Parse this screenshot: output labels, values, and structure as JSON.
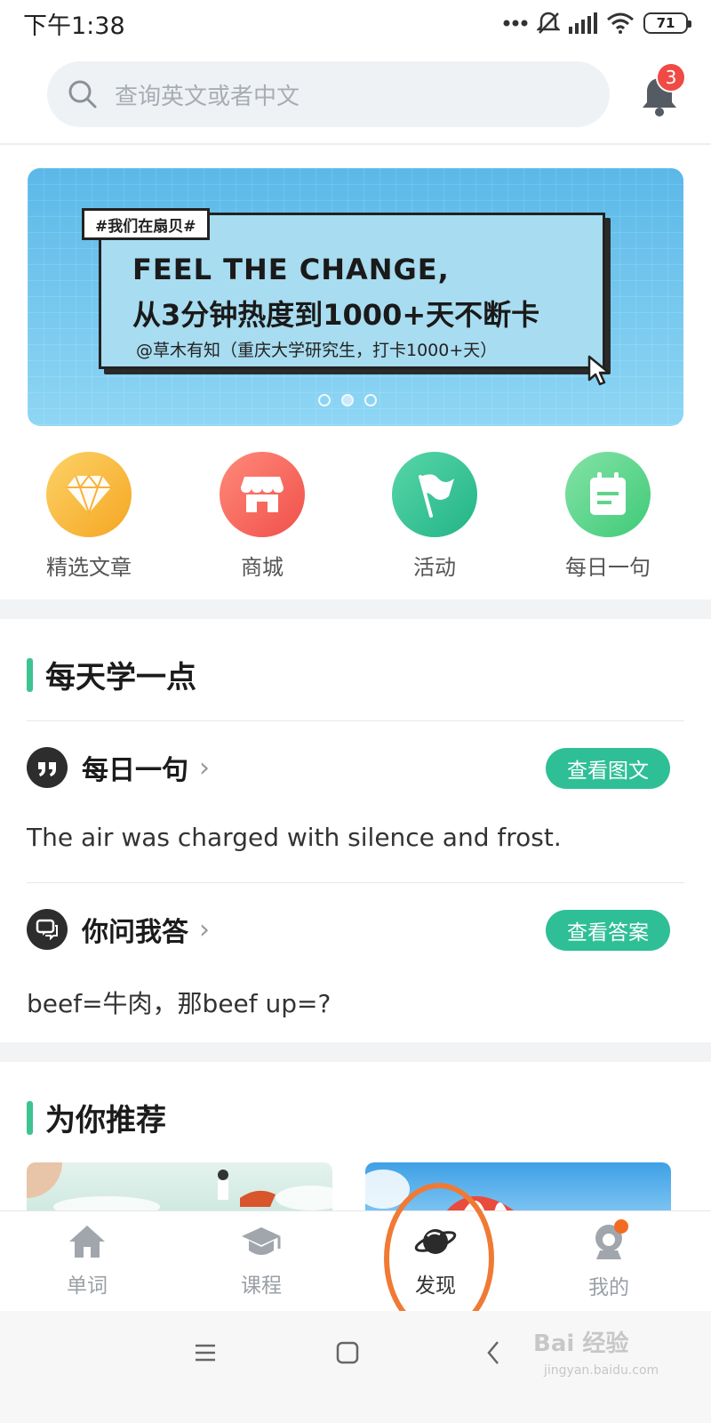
{
  "status": {
    "time": "下午1:38",
    "battery": "71"
  },
  "header": {
    "search_placeholder": "查询英文或者中文",
    "notification_count": "3"
  },
  "banner": {
    "tag": "#我们在扇贝#",
    "title_line1": "FEEL THE CHANGE,",
    "title_line2": "从3分钟热度到1000+天不断卡",
    "subtitle": "@草木有知（重庆大学研究生，打卡1000+天）",
    "page_count": 3,
    "active_page": 1
  },
  "quick_links": [
    {
      "label": "精选文章",
      "icon": "diamond-icon",
      "color": "#f8b23a"
    },
    {
      "label": "商城",
      "icon": "store-icon",
      "color": "#f5625a"
    },
    {
      "label": "活动",
      "icon": "flag-icon",
      "color": "#34c49a"
    },
    {
      "label": "每日一句",
      "icon": "calendar-icon",
      "color": "#5ed48c"
    }
  ],
  "daily": {
    "section_title": "每天学一点",
    "sentence": {
      "title": "每日一句",
      "button": "查看图文",
      "text": "The air was charged with silence and frost."
    },
    "qa": {
      "title": "你问我答",
      "button": "查看答案",
      "text": "beef=牛肉，那beef up=?"
    }
  },
  "recommend": {
    "section_title": "为你推荐"
  },
  "tabs": [
    {
      "label": "单词",
      "icon": "home-icon"
    },
    {
      "label": "课程",
      "icon": "graduation-cap-icon"
    },
    {
      "label": "发现",
      "icon": "planet-icon",
      "active": true
    },
    {
      "label": "我的",
      "icon": "profile-icon"
    }
  ],
  "watermark": {
    "text": "Bai 经验",
    "sub": "jingyan.baidu.com"
  },
  "colors": {
    "accent": "#2fbf97",
    "highlight": "#f07a35",
    "badge": "#f04a45"
  }
}
